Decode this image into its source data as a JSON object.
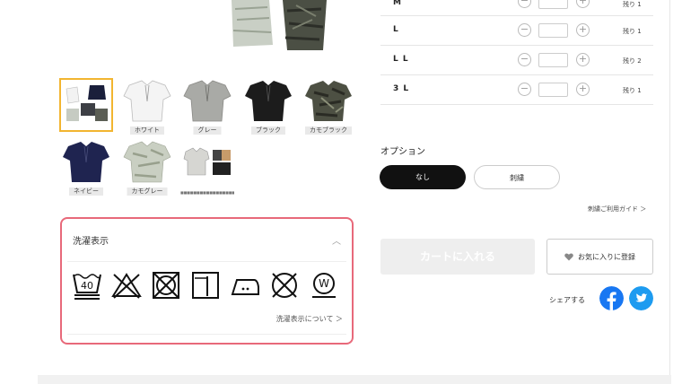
{
  "sizes": [
    {
      "label": "M",
      "stock": "残り 1"
    },
    {
      "label": "L",
      "stock": "残り 1"
    },
    {
      "label": "L L",
      "stock": "残り 2"
    },
    {
      "label": "3 L",
      "stock": "残り 1"
    }
  ],
  "thumbnails": [
    {
      "caption": ""
    },
    {
      "caption": "ホワイト"
    },
    {
      "caption": "グレー"
    },
    {
      "caption": "ブラック"
    },
    {
      "caption": "カモブラック"
    },
    {
      "caption": "ネイビー"
    },
    {
      "caption": "カモグレー"
    },
    {
      "caption": ""
    }
  ],
  "wash": {
    "title": "洗濯表示",
    "link": "洗濯表示について ＞",
    "temp": "40",
    "icons": [
      "wash-40-icon",
      "no-bleach-icon",
      "no-tumble-dry-icon",
      "line-dry-icon",
      "iron-low-icon",
      "no-dry-clean-icon",
      "wet-clean-icon"
    ]
  },
  "option": {
    "title": "オプション",
    "none_label": "なし",
    "embroidery_label": "刺繍",
    "guide_link": "刺繍ご利用ガイド ＞"
  },
  "actions": {
    "cart_label": "カートに入れる",
    "favorite_label": "お気に入りに登録",
    "share_label": "シェアする"
  },
  "colors": {
    "accent_selected": "#f2b530",
    "wash_border": "#e8697a",
    "facebook": "#1877f2",
    "twitter": "#1d9bf0"
  }
}
